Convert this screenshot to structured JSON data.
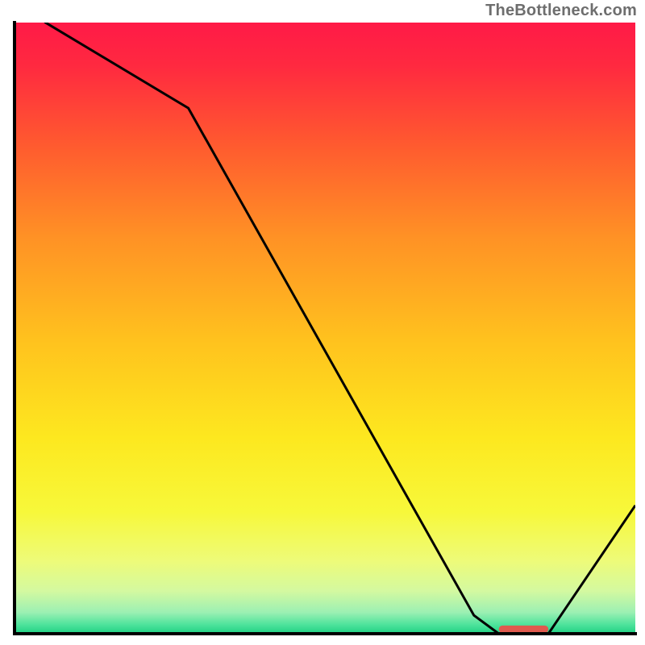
{
  "watermark": "TheBottleneck.com",
  "chart_data": {
    "type": "line",
    "title": "",
    "xlabel": "",
    "ylabel": "",
    "xlim": [
      0,
      100
    ],
    "ylim": [
      0,
      100
    ],
    "x": [
      0,
      5,
      28,
      74,
      78,
      86,
      100
    ],
    "values": [
      105,
      100,
      86,
      3,
      0,
      0,
      21
    ],
    "gradient_stops": [
      {
        "offset": 0.0,
        "color": "#ff1a47"
      },
      {
        "offset": 0.07,
        "color": "#ff2940"
      },
      {
        "offset": 0.2,
        "color": "#ff5a2f"
      },
      {
        "offset": 0.35,
        "color": "#ff9125"
      },
      {
        "offset": 0.52,
        "color": "#ffc21e"
      },
      {
        "offset": 0.68,
        "color": "#fde81f"
      },
      {
        "offset": 0.8,
        "color": "#f7f83a"
      },
      {
        "offset": 0.88,
        "color": "#eefb78"
      },
      {
        "offset": 0.93,
        "color": "#d4f9a0"
      },
      {
        "offset": 0.965,
        "color": "#9cf0b3"
      },
      {
        "offset": 0.985,
        "color": "#4ee39c"
      },
      {
        "offset": 1.0,
        "color": "#1fd083"
      }
    ],
    "marker": {
      "x_start": 78,
      "x_end": 86,
      "y": 0,
      "color": "#e05a4e",
      "thickness": 1.2
    },
    "axis": {
      "line_width": 4,
      "color": "#000000"
    },
    "series_style": {
      "color": "#000000",
      "width": 3
    }
  }
}
